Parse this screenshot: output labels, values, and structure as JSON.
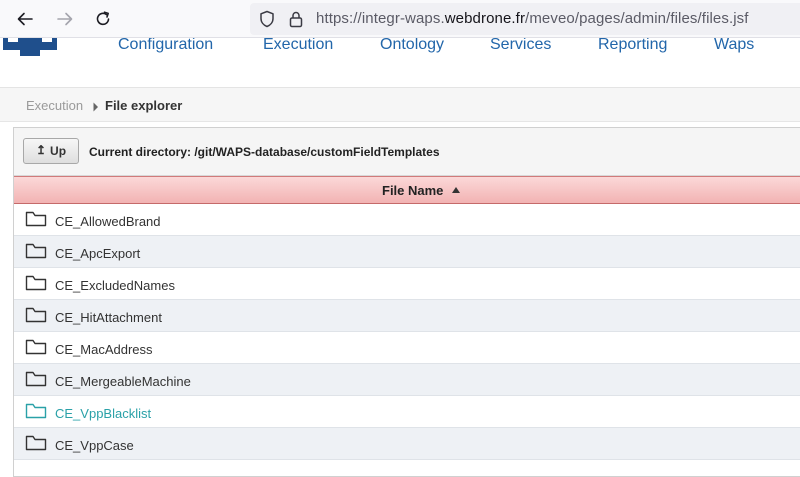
{
  "browser": {
    "url_prefix": "https://integr-waps.",
    "url_domain": "webdrone.fr",
    "url_path": "/meveo/pages/admin/files/files.jsf",
    "icons": [
      "back-icon",
      "forward-icon",
      "reload-icon",
      "shield-icon",
      "lock-icon"
    ]
  },
  "nav": {
    "items": [
      {
        "label": "Configuration"
      },
      {
        "label": "Execution"
      },
      {
        "label": "Ontology"
      },
      {
        "label": "Services"
      },
      {
        "label": "Reporting"
      },
      {
        "label": "Waps"
      }
    ]
  },
  "breadcrumb": {
    "parent": "Execution",
    "current": "File explorer"
  },
  "toolbar": {
    "up_label": "Up",
    "up_glyph": "↥",
    "current_directory": "Current directory: /git/WAPS-database/customFieldTemplates"
  },
  "table": {
    "column_header": "File Name",
    "sort": "ascending",
    "rows": [
      {
        "name": "CE_AllowedBrand",
        "active": false
      },
      {
        "name": "CE_ApcExport",
        "active": false
      },
      {
        "name": "CE_ExcludedNames",
        "active": false
      },
      {
        "name": "CE_HitAttachment",
        "active": false
      },
      {
        "name": "CE_MacAddress",
        "active": false
      },
      {
        "name": "CE_MergeableMachine",
        "active": false
      },
      {
        "name": "CE_VppBlacklist",
        "active": true
      },
      {
        "name": "CE_VppCase",
        "active": false
      }
    ]
  },
  "colors": {
    "nav_link": "#2266aa",
    "header_bg": "#f2b3b3",
    "active_row_text": "#2aa1a8",
    "folder_icon": "#333333"
  }
}
